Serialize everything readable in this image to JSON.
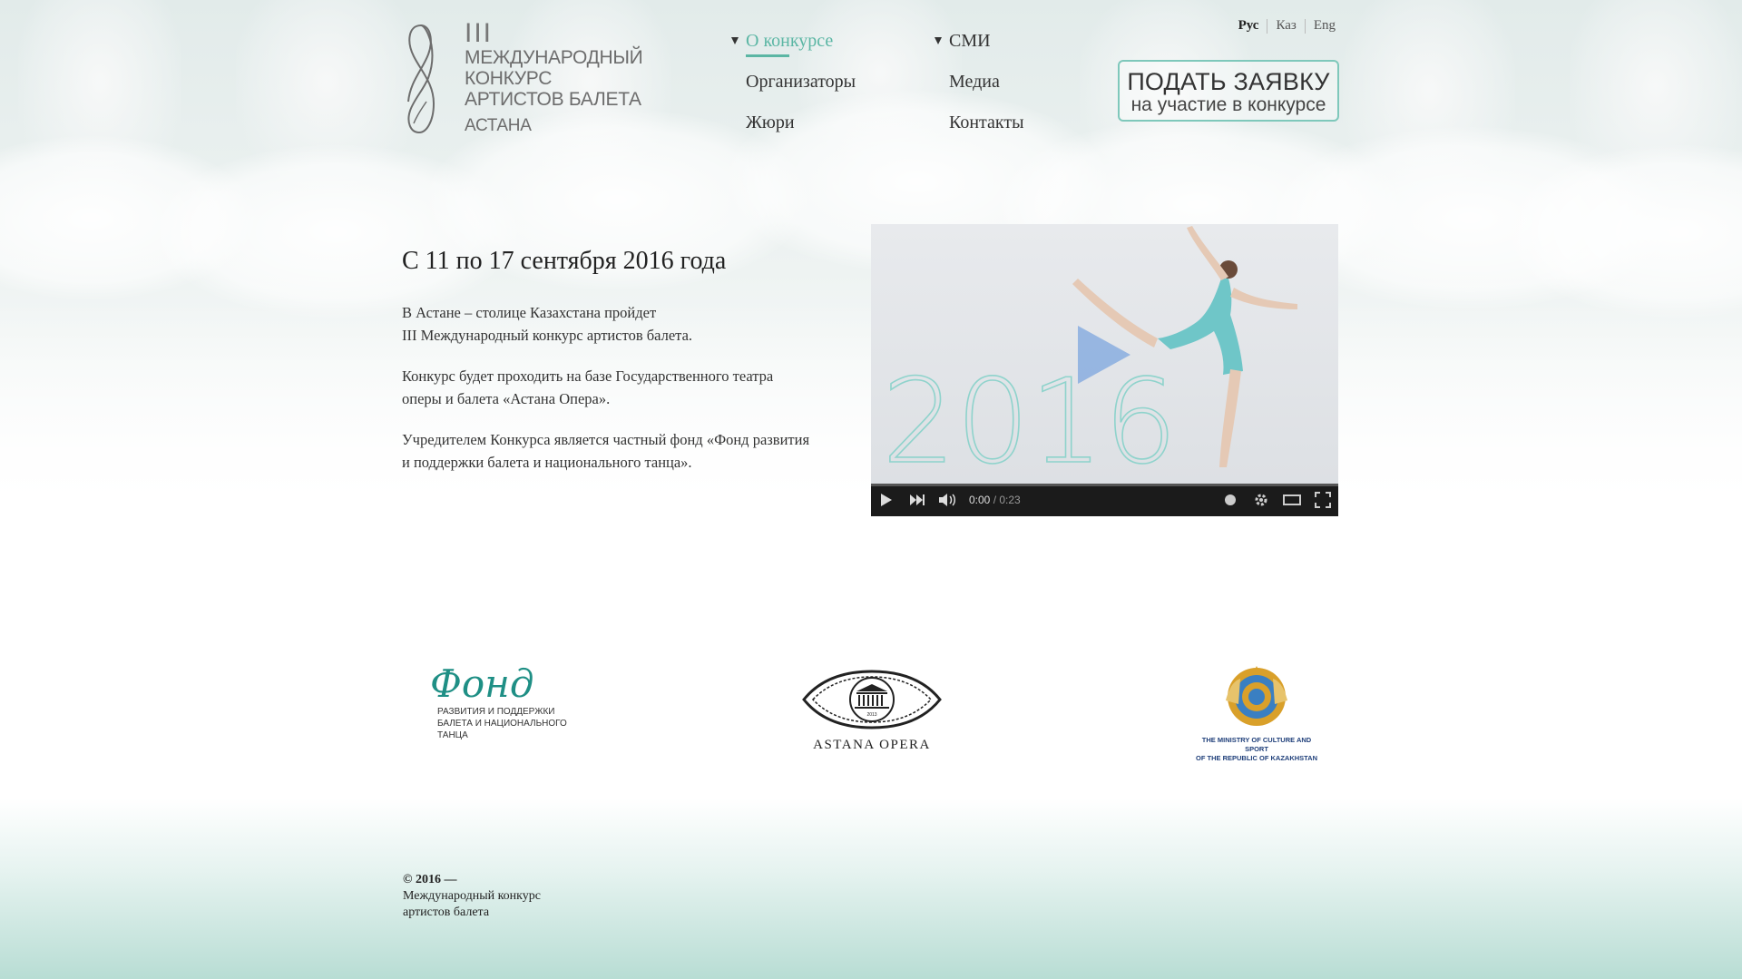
{
  "logo": {
    "numeral": "III",
    "lines": [
      "МЕЖДУНАРОДНЫЙ",
      "КОНКУРС",
      "АРТИСТОВ БАЛЕТА"
    ],
    "city": "АСТАНА"
  },
  "nav": {
    "col1": [
      {
        "label": "О конкурсе",
        "active": true,
        "has_submenu": true
      },
      {
        "label": "Организаторы"
      },
      {
        "label": "Жюри"
      }
    ],
    "col2": [
      {
        "label": "СМИ",
        "has_submenu": true
      },
      {
        "label": "Медиа"
      },
      {
        "label": "Контакты"
      }
    ]
  },
  "languages": {
    "items": [
      "Рус",
      "Каз",
      "Eng"
    ],
    "current": "Рус"
  },
  "apply_button": {
    "line1": "ПОДАТЬ ЗАЯВКУ",
    "line2": "на участие в конкурсе"
  },
  "main": {
    "heading": "С 11 по 17 сентября 2016 года",
    "paragraphs": [
      {
        "l1": "В Астане – столице Казахстана пройдет",
        "l2": "III Международный конкурс артистов балета."
      },
      {
        "l1": "Конкурс будет проходить на базе Государственного театра",
        "l2": "оперы и балета «Астана Опера»."
      },
      {
        "l1": "Учредителем Конкурса является частный фонд «Фонд развития",
        "l2": "и поддержки балета и национального танца»."
      }
    ]
  },
  "video": {
    "overlay_year": "2016",
    "current_time": "0:00",
    "separator": " / ",
    "duration": "0:23",
    "progress": 0
  },
  "partners": {
    "fond": {
      "word": "Фонд",
      "sub": [
        "РАЗВИТИЯ И ПОДДЕРЖКИ",
        "БАЛЕТА И НАЦИОНАЛЬНОГО",
        "ТАНЦА"
      ]
    },
    "opera": {
      "name": "ASTANA OPERA",
      "year": "2013"
    },
    "ministry": {
      "lines": [
        "THE MINISTRY OF CULTURE AND SPORT",
        "OF THE REPUBLIC OF KAZAKHSTAN"
      ]
    }
  },
  "footer": {
    "copyright": "© 2016 —",
    "lines": [
      "Международный конкурс",
      "артистов балета"
    ]
  },
  "colors": {
    "accent": "#5bb6a4",
    "button_border": "#7fc8bb",
    "video_controls": "#1b1b1b",
    "fond_green": "#1f8f85",
    "ministry_blue": "#1f3f7a"
  },
  "icons": [
    "logo-mark-icon",
    "play-icon",
    "next-icon",
    "volume-icon",
    "annotation-icon",
    "settings-icon",
    "theater-mode-icon",
    "fullscreen-icon",
    "opera-emblem-icon",
    "kz-emblem-icon"
  ]
}
